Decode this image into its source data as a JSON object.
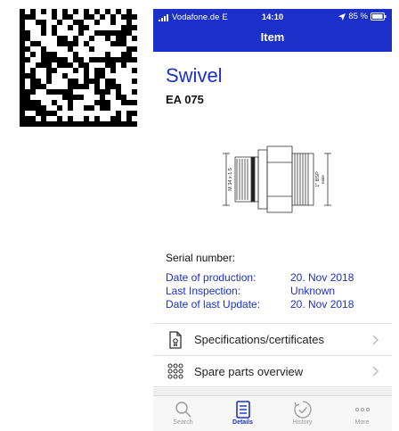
{
  "status_bar": {
    "carrier": "Vodafone.de",
    "network": "E",
    "time": "14:10",
    "battery": "85 %"
  },
  "nav": {
    "title": "Item"
  },
  "item": {
    "name": "Swivel",
    "code": "EA 075",
    "drawing_labels": {
      "thread_left": "M 34 x 1.5",
      "thread_right": "1\" BSP",
      "thread_right_sub": "male"
    }
  },
  "serial": {
    "label": "Serial number:"
  },
  "details": [
    {
      "label": "Date of production:",
      "value": "20. Nov 2018"
    },
    {
      "label": "Last Inspection:",
      "value": "Unknown"
    },
    {
      "label": "Date of last Update:",
      "value": "20. Nov 2018"
    }
  ],
  "menu": {
    "specifications": "Specifications/certificates",
    "spare_parts": "Spare parts overview"
  },
  "tabs": [
    {
      "label": "Search"
    },
    {
      "label": "Details"
    },
    {
      "label": "History"
    },
    {
      "label": "More"
    }
  ],
  "colors": {
    "brand_blue": "#1a30c8",
    "tab_inactive": "#9a9a9a"
  }
}
